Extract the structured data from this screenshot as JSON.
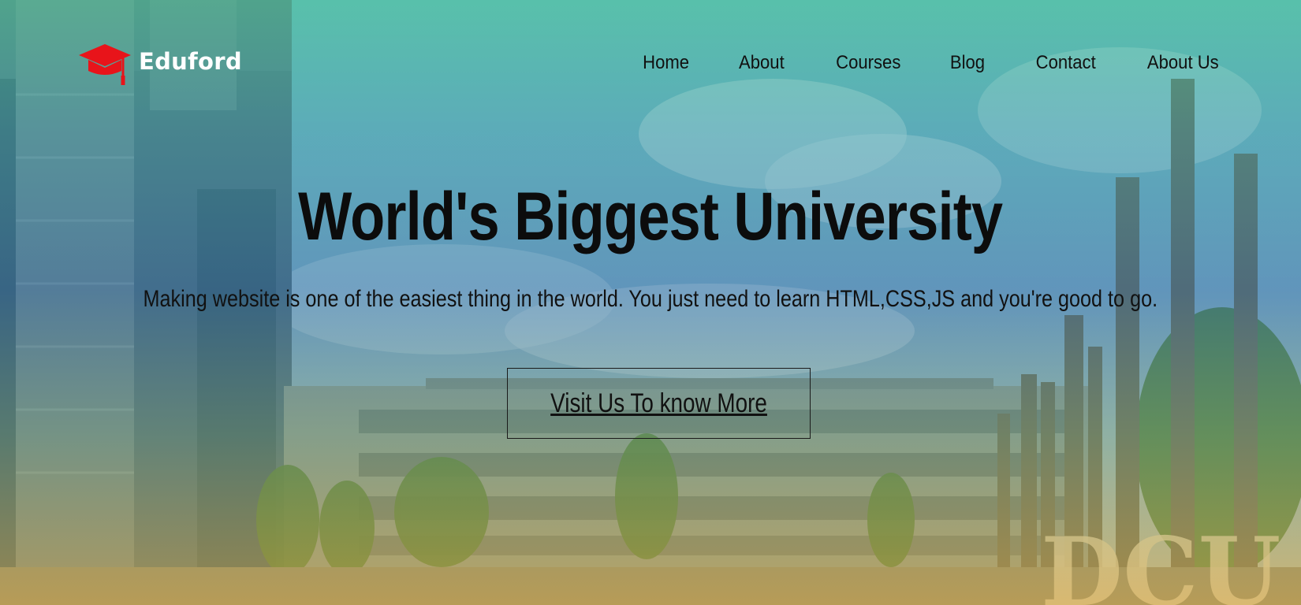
{
  "brand": {
    "name": "Eduford",
    "logo_icon": "graduation-cap-icon",
    "logo_color": "#e8141a"
  },
  "nav": {
    "items": [
      "Home",
      "About",
      "Courses",
      "Blog",
      "Contact",
      "About Us"
    ]
  },
  "hero": {
    "title": "World's Biggest University",
    "subtitle": "Making website is one of the easiest thing in the world. You just need to learn HTML,CSS,JS and you're good to go.",
    "cta_label": "Visit Us To know More",
    "background_watermark": "DCU"
  }
}
